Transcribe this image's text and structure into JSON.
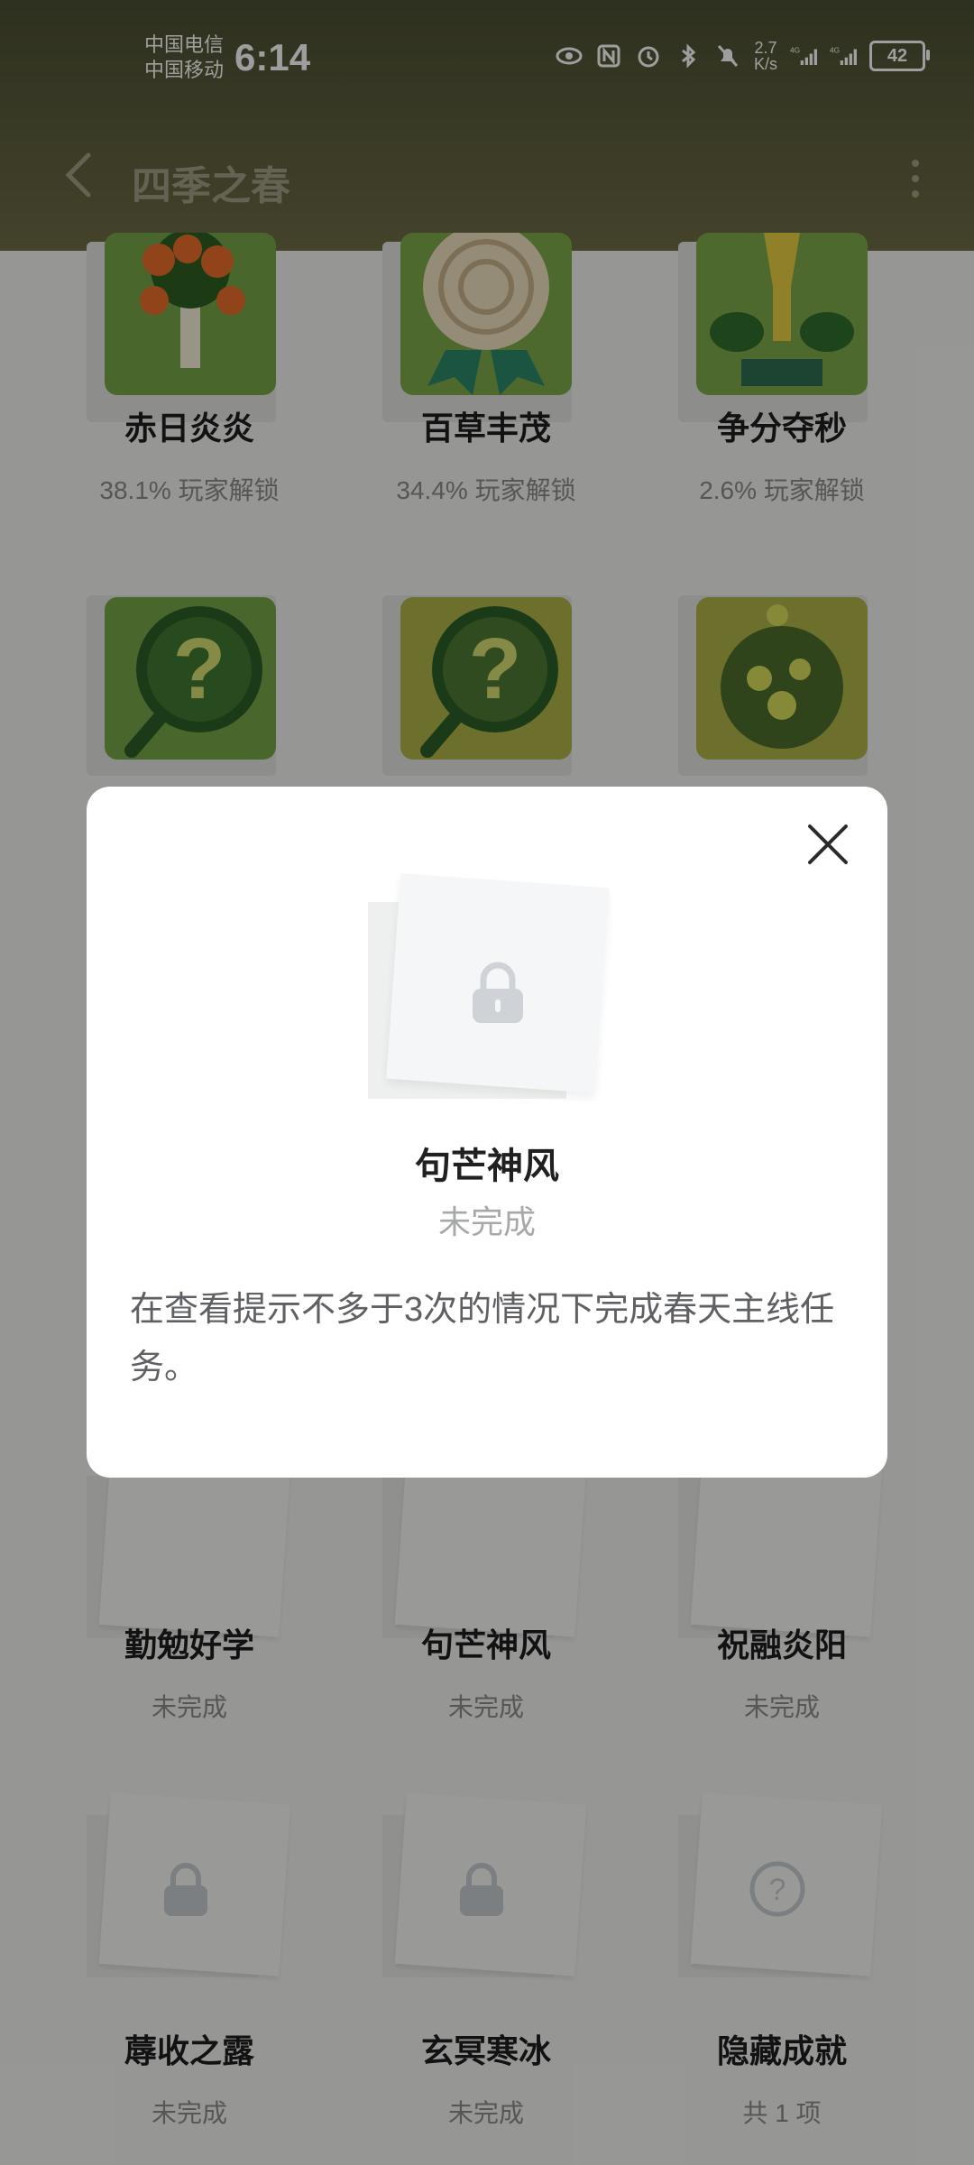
{
  "status_bar": {
    "carrier_1": "中国电信",
    "carrier_2": "中国移动",
    "time": "6:14",
    "net_speed_value": "2.7",
    "net_speed_unit": "K/s",
    "battery": "42",
    "icons": [
      "eye-icon",
      "nfc-icon",
      "alarm-icon",
      "bluetooth-icon",
      "mute-bell-icon",
      "signal-4g-icon",
      "signal-4g-icon"
    ]
  },
  "nav": {
    "title": "四季之春"
  },
  "grid": {
    "row1": [
      {
        "name": "赤日炎炎",
        "sub": "38.1% 玩家解锁",
        "icon": "orange-tree-icon"
      },
      {
        "name": "百草丰茂",
        "sub": "34.4% 玩家解锁",
        "icon": "wood-medal-icon"
      },
      {
        "name": "争分夺秒",
        "sub": "2.6% 玩家解锁",
        "icon": "hourglass-icon"
      }
    ],
    "row2_icons": [
      "question-magnifier-icon",
      "question-magnifier-icon",
      "moss-ball-icon"
    ],
    "row4": [
      {
        "name": "勤勉好学",
        "sub": "未完成"
      },
      {
        "name": "句芒神风",
        "sub": "未完成"
      },
      {
        "name": "祝融炎阳",
        "sub": "未完成"
      }
    ],
    "row5": [
      {
        "name": "蓐收之露",
        "sub": "未完成",
        "icon": "lock-icon"
      },
      {
        "name": "玄冥寒冰",
        "sub": "未完成",
        "icon": "lock-icon"
      },
      {
        "name": "隐藏成就",
        "sub": "共 1 项",
        "icon": "question-circle-icon"
      }
    ]
  },
  "modal": {
    "title": "句芒神风",
    "status": "未完成",
    "description": "在查看提示不多于3次的情况下完成春天主线任务。",
    "icon": "lock-icon"
  },
  "colors": {
    "header_dark": "#4b4f33",
    "badge_green": "#6e9a3e",
    "badge_olive": "#a9b046"
  }
}
